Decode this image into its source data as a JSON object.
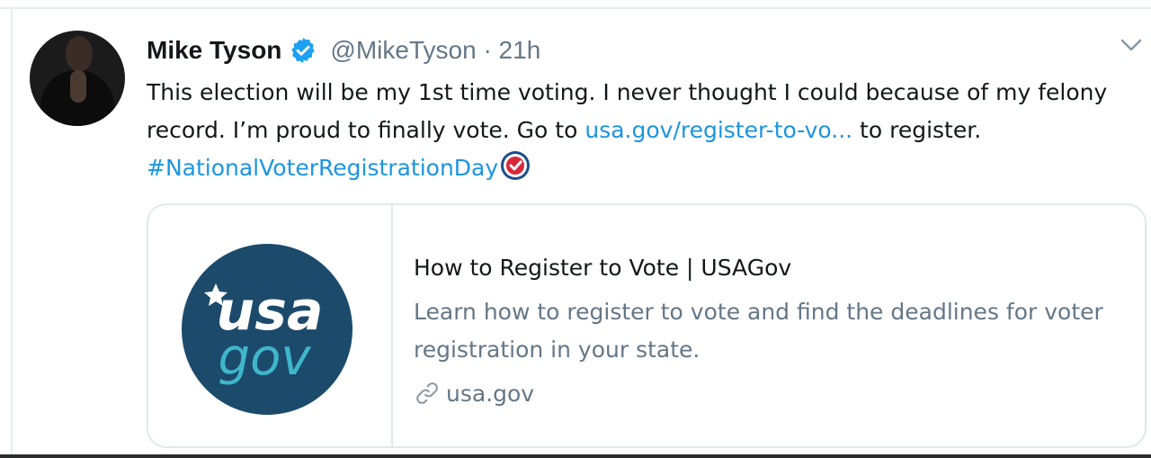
{
  "tweet": {
    "author_name": "Mike Tyson",
    "handle": "@MikeTyson",
    "separator": "·",
    "time": "21h",
    "text_part1": "This election will be my 1st time voting. I never thought I could because of my felony record. I’m proud to finally vote. Go to ",
    "link_text": "usa.gov/register-to-vo...",
    "text_part2": " to register. ",
    "hashtag": "#NationalVoterRegistrationDay"
  },
  "card": {
    "title": "How to Register to Vote | USAGov",
    "description": "Learn how to register to vote and find the deadlines for voter registration in your state.",
    "domain": "usa.gov",
    "logo_text_top": "usa",
    "logo_text_bottom": "gov"
  },
  "icons": {
    "verified": "verified-badge-icon",
    "caret": "chevron-down-icon",
    "link": "link-icon",
    "hashflag": "ballot-hashflag-icon"
  },
  "colors": {
    "link_blue": "#1b95e0",
    "verified_blue": "#1da1f2",
    "secondary_text": "#657786",
    "logo_navy": "#1c4a6b",
    "logo_teal": "#3fb6c9"
  }
}
